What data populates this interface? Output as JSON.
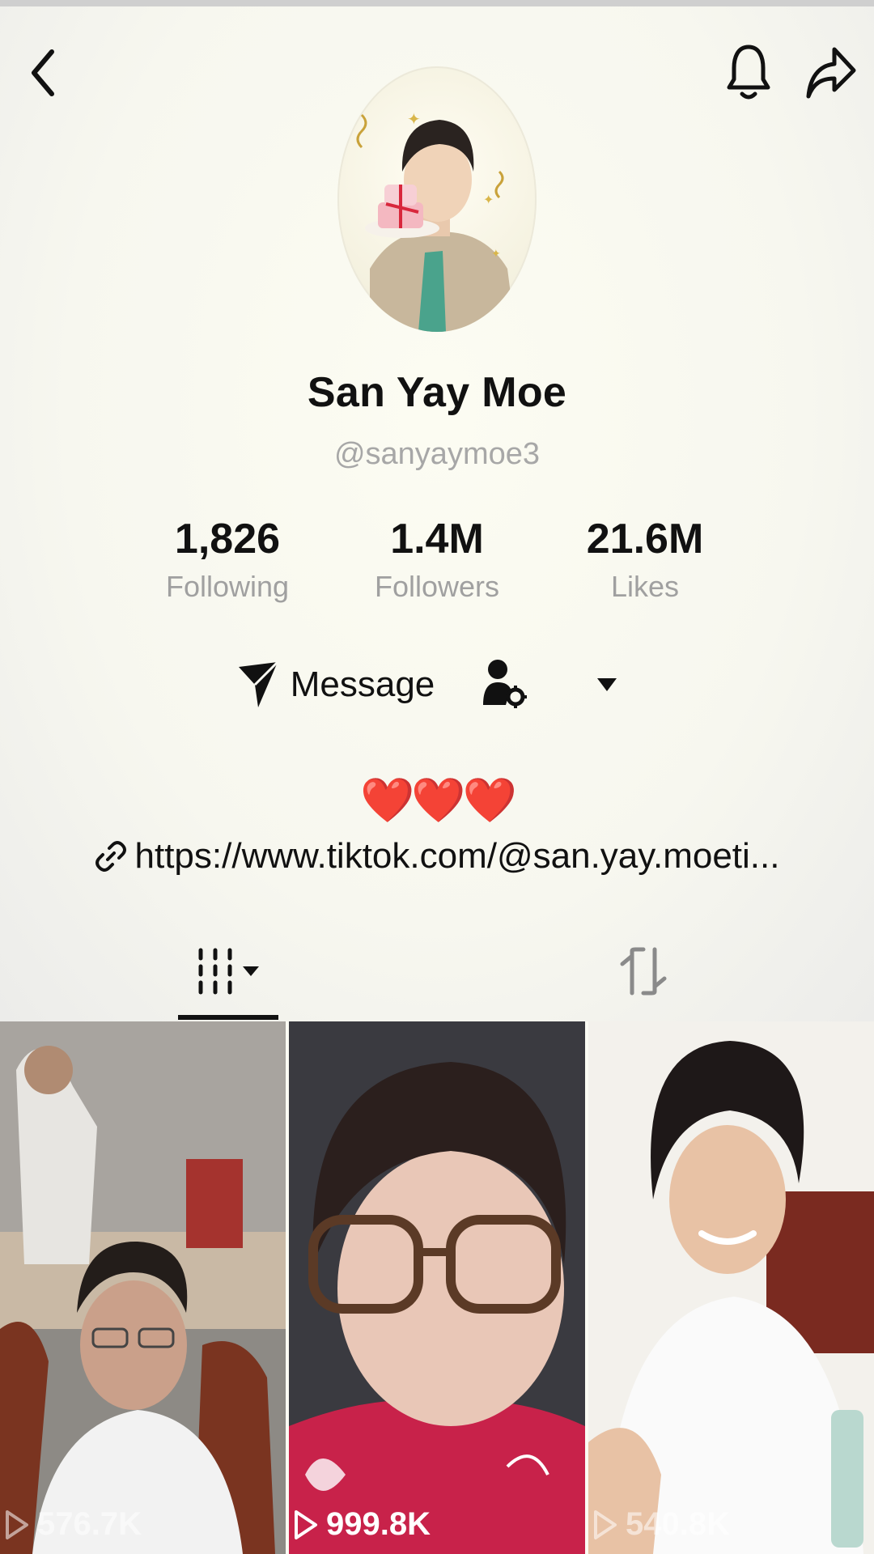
{
  "header": {
    "back_icon": "chevron-left-icon",
    "bell_icon": "bell-icon",
    "share_icon": "share-arrow-icon"
  },
  "profile": {
    "name": "San Yay Moe",
    "handle": "@sanyaymoe3"
  },
  "stats": [
    {
      "value": "1,826",
      "label": "Following"
    },
    {
      "value": "1.4M",
      "label": "Followers"
    },
    {
      "value": "21.6M",
      "label": "Likes"
    }
  ],
  "actions": {
    "message_label": "Message",
    "message_icon": "send-icon",
    "friend_icon": "person-gear-icon",
    "more_icon": "caret-down-icon"
  },
  "bio": {
    "hearts": "❤️❤️❤️",
    "link_icon": "link-icon",
    "link": "https://www.tiktok.com/@san.yay.moeti..."
  },
  "tabs": {
    "videos_icon": "grid-icon",
    "reposts_icon": "repost-icon"
  },
  "videos": [
    {
      "views": "576.7K",
      "play_icon": "play-icon"
    },
    {
      "views": "999.8K",
      "play_icon": "play-icon"
    },
    {
      "views": "540.8K",
      "play_icon": "play-icon"
    }
  ],
  "colors": {
    "background": "#fbfbf3",
    "muted_text": "#a0a0a0",
    "heart": "#e02424"
  }
}
